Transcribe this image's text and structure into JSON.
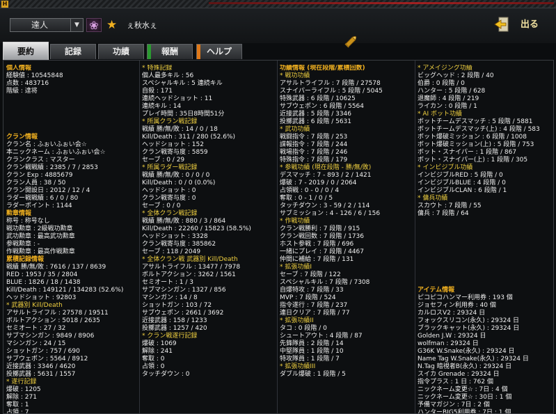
{
  "title_bar": {
    "logo": "H"
  },
  "header": {
    "rank": "達人",
    "player_name": "ぇ秋水ぇ",
    "exit_label": "出る",
    "icons": {
      "clan": "clan-emblem-icon",
      "star": "star-icon",
      "bullet": "bullet-icon",
      "exit": "exit-icon"
    }
  },
  "tabs": [
    {
      "label": "要約",
      "active": true,
      "mark": ""
    },
    {
      "label": "記録",
      "active": false,
      "mark": ""
    },
    {
      "label": "功績",
      "active": false,
      "mark": ""
    },
    {
      "label": "報酬",
      "active": false,
      "mark": "#2a9a30"
    },
    {
      "label": "ヘルプ",
      "active": false,
      "mark": "#e07818"
    }
  ],
  "columns": [
    [
      {
        "t": "hd",
        "text": "個人情報"
      },
      {
        "t": "line",
        "text": "経験値 : 10545848"
      },
      {
        "t": "line",
        "text": "点数 : 483716"
      },
      {
        "t": "line",
        "text": "階級 : 達将"
      },
      {
        "t": "sp"
      },
      {
        "t": "sp"
      },
      {
        "t": "sp"
      },
      {
        "t": "sp"
      },
      {
        "t": "sp"
      },
      {
        "t": "hd",
        "text": "クラン情報"
      },
      {
        "t": "line",
        "text": "クラン名 : ふぉいふぉい会☆"
      },
      {
        "t": "line",
        "text": "本ニックネーム : ふぉいふぉい会☆"
      },
      {
        "t": "line",
        "text": "クランクラス : マスター"
      },
      {
        "t": "line",
        "text": "クラン戦戦績 : 2385 / 7 / 2853"
      },
      {
        "t": "line",
        "text": "クラン Exp : 4885679"
      },
      {
        "t": "line",
        "text": "クラン人員 : 38 / 50"
      },
      {
        "t": "line",
        "text": "クラン開設日 : 2012 / 12 / 4"
      },
      {
        "t": "line",
        "text": "ラダー戦戦績 : 6 / 0 / 80"
      },
      {
        "t": "line",
        "text": "ラダーポイント : 1144"
      },
      {
        "t": "hd",
        "text": "勲章情報"
      },
      {
        "t": "line",
        "text": "称号 : 称号なし"
      },
      {
        "t": "line",
        "text": "戦功勲章 : 2級戦功勲章"
      },
      {
        "t": "line",
        "text": "武功勲章 : 最高武功勲章"
      },
      {
        "t": "line",
        "text": "参戦勲章 : -"
      },
      {
        "t": "line",
        "text": "作戦勲章 : 最高作戦勲章"
      },
      {
        "t": "hd",
        "text": "累積記録情報"
      },
      {
        "t": "line",
        "text": "戦績  勝/無/敗 : 7616 / 137 / 8639"
      },
      {
        "t": "line",
        "text": "RED : 1953 / 35 / 2804"
      },
      {
        "t": "line",
        "text": "BLUE : 1826 / 18 / 1438"
      },
      {
        "t": "line",
        "text": "Kill/Death : 149121 / 134283 (52.6%)"
      },
      {
        "t": "line",
        "text": "ヘッドショット : 92803"
      },
      {
        "t": "sub",
        "text": "* 武器別 Kill/Death"
      },
      {
        "t": "line",
        "text": "アサルトライフル : 27578 / 19511"
      },
      {
        "t": "line",
        "text": "ボルトアクション : 5018 / 2635"
      },
      {
        "t": "line",
        "text": "セミオート : 27 / 32"
      },
      {
        "t": "line",
        "text": "サブマシンガン : 9849 / 8906"
      },
      {
        "t": "line",
        "text": "マシンガン : 24 / 15"
      },
      {
        "t": "line",
        "text": "ショットガン : 757 / 690"
      },
      {
        "t": "line",
        "text": "サブウェポン : 5564 / 8912"
      },
      {
        "t": "line",
        "text": "近接武器 : 3346 / 4620"
      },
      {
        "t": "line",
        "text": "投擲武器 : 5631 / 1557"
      },
      {
        "t": "sub",
        "text": "* 遂行記録"
      },
      {
        "t": "line",
        "text": "爆破 : 1205"
      },
      {
        "t": "line",
        "text": "解除 : 271"
      },
      {
        "t": "line",
        "text": "奪取 : 1"
      },
      {
        "t": "line",
        "text": "占領 : 7"
      },
      {
        "t": "line",
        "text": "タッチダウン : 34"
      }
    ],
    [
      {
        "t": "sub",
        "text": "* 特殊記録"
      },
      {
        "t": "line",
        "text": "個人最多キル : 56"
      },
      {
        "t": "line",
        "text": "スペシャルキル : 5 連続キル"
      },
      {
        "t": "line",
        "text": "自殺 : 171"
      },
      {
        "t": "line",
        "text": "連続ヘッドショット : 11"
      },
      {
        "t": "line",
        "text": "連続キル : 14"
      },
      {
        "t": "line",
        "text": "プレイ時間 : 35日8時間51分"
      },
      {
        "t": "sub",
        "text": "* 所属クラン戦記録"
      },
      {
        "t": "line",
        "text": "戦績  勝/無/敗 : 14 / 0 / 18"
      },
      {
        "t": "line",
        "text": "Kill/Death : 311 / 280 (52.6%)"
      },
      {
        "t": "line",
        "text": "ヘッドショット : 152"
      },
      {
        "t": "line",
        "text": "クラン戦寄与度 : 5859"
      },
      {
        "t": "line",
        "text": "セーブ : 0 / 29"
      },
      {
        "t": "sub",
        "text": "* 所属ラダー戦記録"
      },
      {
        "t": "line",
        "text": "戦績  勝/無/敗 : 0 / 0 / 0"
      },
      {
        "t": "line",
        "text": "Kill/Death : 0 / 0 (0.0%)"
      },
      {
        "t": "line",
        "text": "ヘッドショット : 0"
      },
      {
        "t": "line",
        "text": "クラン戦寄与度 : 0"
      },
      {
        "t": "line",
        "text": "セーブ : 0 / 0"
      },
      {
        "t": "sub",
        "text": "* 全体クラン戦記録"
      },
      {
        "t": "line",
        "text": "戦績  勝/無/敗 : 880 / 3 / 864"
      },
      {
        "t": "line",
        "text": "Kill/Death : 22260 / 15823 (58.5%)"
      },
      {
        "t": "line",
        "text": "ヘッドショット : 3328"
      },
      {
        "t": "line",
        "text": "クラン戦寄与度 : 385862"
      },
      {
        "t": "line",
        "text": "セーブ : 118 / 2049"
      },
      {
        "t": "sub",
        "text": "* 全体クラン戦 武器別 Kill/Death"
      },
      {
        "t": "line",
        "text": "アサルトライフル : 13477 / 7978"
      },
      {
        "t": "line",
        "text": "ボルトアクション : 3262 / 1561"
      },
      {
        "t": "line",
        "text": "セミオート : 1 / 3"
      },
      {
        "t": "line",
        "text": "サブマシンガン : 1327 / 856"
      },
      {
        "t": "line",
        "text": "マシンガン : 14 / 8"
      },
      {
        "t": "line",
        "text": "ショットガン : 103 / 72"
      },
      {
        "t": "line",
        "text": "サブウェポン : 2661 / 3692"
      },
      {
        "t": "line",
        "text": "近接武器 : 158 / 1233"
      },
      {
        "t": "line",
        "text": "投擲武器 : 1257 / 420"
      },
      {
        "t": "sub",
        "text": "* クラン戦遂行記録"
      },
      {
        "t": "line",
        "text": "爆破 : 1069"
      },
      {
        "t": "line",
        "text": "解除 : 241"
      },
      {
        "t": "line",
        "text": "奪取 : 0"
      },
      {
        "t": "line",
        "text": "占領 : 0"
      },
      {
        "t": "line",
        "text": "タッチダウン : 0"
      }
    ],
    [
      {
        "t": "hd",
        "text": "功績情報 (現在段階/累積回数)"
      },
      {
        "t": "sub",
        "text": "* 戦功功績"
      },
      {
        "t": "line",
        "text": "アサルトライフル : 7 段階 / 27578"
      },
      {
        "t": "line",
        "text": "スナイパーライフル : 5 段階 / 5045"
      },
      {
        "t": "line",
        "text": "特殊武器 : 6 段階 / 10625"
      },
      {
        "t": "line",
        "text": "サブウェポン : 6 段階 / 5564"
      },
      {
        "t": "line",
        "text": "近接武器 : 5 段階 / 3346"
      },
      {
        "t": "line",
        "text": "投擲武器 : 6 段階 / 5631"
      },
      {
        "t": "sub",
        "text": "* 武功功績"
      },
      {
        "t": "line",
        "text": "戦闘指令 : 7 段階 / 253"
      },
      {
        "t": "line",
        "text": "諜報指令 : 7 段階 / 244"
      },
      {
        "t": "line",
        "text": "戦場指令 : 7 段階 / 246"
      },
      {
        "t": "line",
        "text": "特殊指令 : 7 段階 / 179"
      },
      {
        "t": "sub",
        "text": "* 参戦功績 (現在段階 - 勝/無/敗)"
      },
      {
        "t": "line",
        "text": "デスマッチ : 7 - 893 / 2 / 1421"
      },
      {
        "t": "line",
        "text": "爆破 : 7 - 2019 / 0 / 2064"
      },
      {
        "t": "line",
        "text": "占領戦 : 0 - 0 / 0 / 4"
      },
      {
        "t": "line",
        "text": "奪取 : 0 - 1 / 0 / 5"
      },
      {
        "t": "line",
        "text": "タッチダウン : 3 - 59 / 2 / 114"
      },
      {
        "t": "line",
        "text": "サブミッション : 4 - 126 / 6 / 156"
      },
      {
        "t": "sub",
        "text": "* 作戦功績"
      },
      {
        "t": "line",
        "text": "クラン戦勝利 : 7 段階 / 915"
      },
      {
        "t": "line",
        "text": "クラン戦回数 : 7 段階 / 1736"
      },
      {
        "t": "line",
        "text": "ホスト参戦 : 7 段階 / 696"
      },
      {
        "t": "line",
        "text": "一緒にプレイ : 7 段階 / 4467"
      },
      {
        "t": "line",
        "text": "仲間に補給 : 7 段階 / 131"
      },
      {
        "t": "sub",
        "text": "* 拡張功績I"
      },
      {
        "t": "line",
        "text": "セーブ : 7 段階 / 122"
      },
      {
        "t": "line",
        "text": "スペシャルキル : 7 段階 / 7308"
      },
      {
        "t": "line",
        "text": "自爆特攻 : 7 段階 / 33"
      },
      {
        "t": "line",
        "text": "MVP : 7 段階 / 524"
      },
      {
        "t": "line",
        "text": "指令遂行 : 7 段階 / 237"
      },
      {
        "t": "line",
        "text": "連日クリア : 7 段階 / 77"
      },
      {
        "t": "sub",
        "text": "* 拡張功績II"
      },
      {
        "t": "line",
        "text": "タコ : 0 段階 / 0"
      },
      {
        "t": "line",
        "text": "シュートアウト : 4 段階 / 87"
      },
      {
        "t": "line",
        "text": "先鋒隊員 : 2 段階 / 14"
      },
      {
        "t": "line",
        "text": "中堅隊員 : 1 段階 / 10"
      },
      {
        "t": "line",
        "text": "特攻隊員 : 1 段階 / 7"
      },
      {
        "t": "sub",
        "text": "* 拡張功績III"
      },
      {
        "t": "line",
        "text": "ダブル爆破 : 1 段階 / 5"
      }
    ],
    [
      {
        "t": "sub",
        "text": "* アメイジング功績"
      },
      {
        "t": "line",
        "text": "ビッグヘッド : 2 段階 / 40"
      },
      {
        "t": "line",
        "text": "伯爵 : 0 段階 / 0"
      },
      {
        "t": "line",
        "text": "ハンター : 5 段階 / 628"
      },
      {
        "t": "line",
        "text": "退魔師 : 4 段階 / 219"
      },
      {
        "t": "line",
        "text": "ライカン : 0 段階 / 1"
      },
      {
        "t": "sub",
        "text": "* AI ボット功績"
      },
      {
        "t": "line",
        "text": "ボットチームデスマッチ : 5 段階 / 5881"
      },
      {
        "t": "line",
        "text": "ボットチームデスマッチ(上) : 4 段階 / 583"
      },
      {
        "t": "line",
        "text": "ボット爆破ミッション : 6 段階 / 1008"
      },
      {
        "t": "line",
        "text": "ボット爆破ミッション(上) : 5 段階 / 753"
      },
      {
        "t": "line",
        "text": "ボット・スナイパー : 1 段階 / 867"
      },
      {
        "t": "line",
        "text": "ボット・スナイパー(上) : 1 段階 / 305"
      },
      {
        "t": "sub",
        "text": "* インビジブル功績"
      },
      {
        "t": "line",
        "text": "インビジブルRED : 5 段階 / 0"
      },
      {
        "t": "line",
        "text": "インビジブルBLUE : 4 段階 / 0"
      },
      {
        "t": "line",
        "text": "インビジブルCLAN : 6 段階 / 1"
      },
      {
        "t": "sub",
        "text": "* 傭兵功績"
      },
      {
        "t": "line",
        "text": "スカウト : 7 段階 / 55"
      },
      {
        "t": "line",
        "text": "傭兵 : 7 段階 / 64"
      },
      {
        "t": "sp"
      },
      {
        "t": "sp"
      },
      {
        "t": "sp"
      },
      {
        "t": "sp"
      },
      {
        "t": "sp"
      },
      {
        "t": "sp"
      },
      {
        "t": "sp"
      },
      {
        "t": "sp"
      },
      {
        "t": "sp"
      },
      {
        "t": "hd",
        "text": "アイテム情報"
      },
      {
        "t": "line",
        "text": "ピコピコハンマー利用券 : 193 個"
      },
      {
        "t": "line",
        "text": "ジョセフィン利用券 : 40 個"
      },
      {
        "t": "line",
        "text": "カルロスV2 : 29324 日"
      },
      {
        "t": "line",
        "text": "フォックスリコン(永久) : 29324 日"
      },
      {
        "t": "line",
        "text": "ブラックキャット(永久) : 29324 日"
      },
      {
        "t": "line",
        "text": "Golden J.W : 29324 日"
      },
      {
        "t": "line",
        "text": "wolfman : 29324 日"
      },
      {
        "t": "line",
        "text": "G36K W.Snake(永久) : 29324 日"
      },
      {
        "t": "line",
        "text": "Name Tag W.Snake(永久) : 29324 日"
      },
      {
        "t": "line",
        "text": "N.Tag 暗視者B(永久) : 29324 日"
      },
      {
        "t": "line",
        "text": "スイカ Grenade : 29324 日"
      },
      {
        "t": "line",
        "text": "指令プラス : 1 日 : 762 個"
      },
      {
        "t": "line",
        "text": "ニックネーム変更☆ : 7日 : 4 個"
      },
      {
        "t": "line",
        "text": "ニックネーム変更☆ : 30日 : 1 個"
      },
      {
        "t": "line",
        "text": "予備マガジン : 7日 : 2 個"
      },
      {
        "t": "line",
        "text": "ハンターBIG5利用券 : 7日 : 1 個"
      },
      {
        "t": "line",
        "text": "指令再発給 : 2 個"
      },
      {
        "t": "line",
        "text": "W-スカウト : 10日 : 1 個"
      }
    ]
  ]
}
